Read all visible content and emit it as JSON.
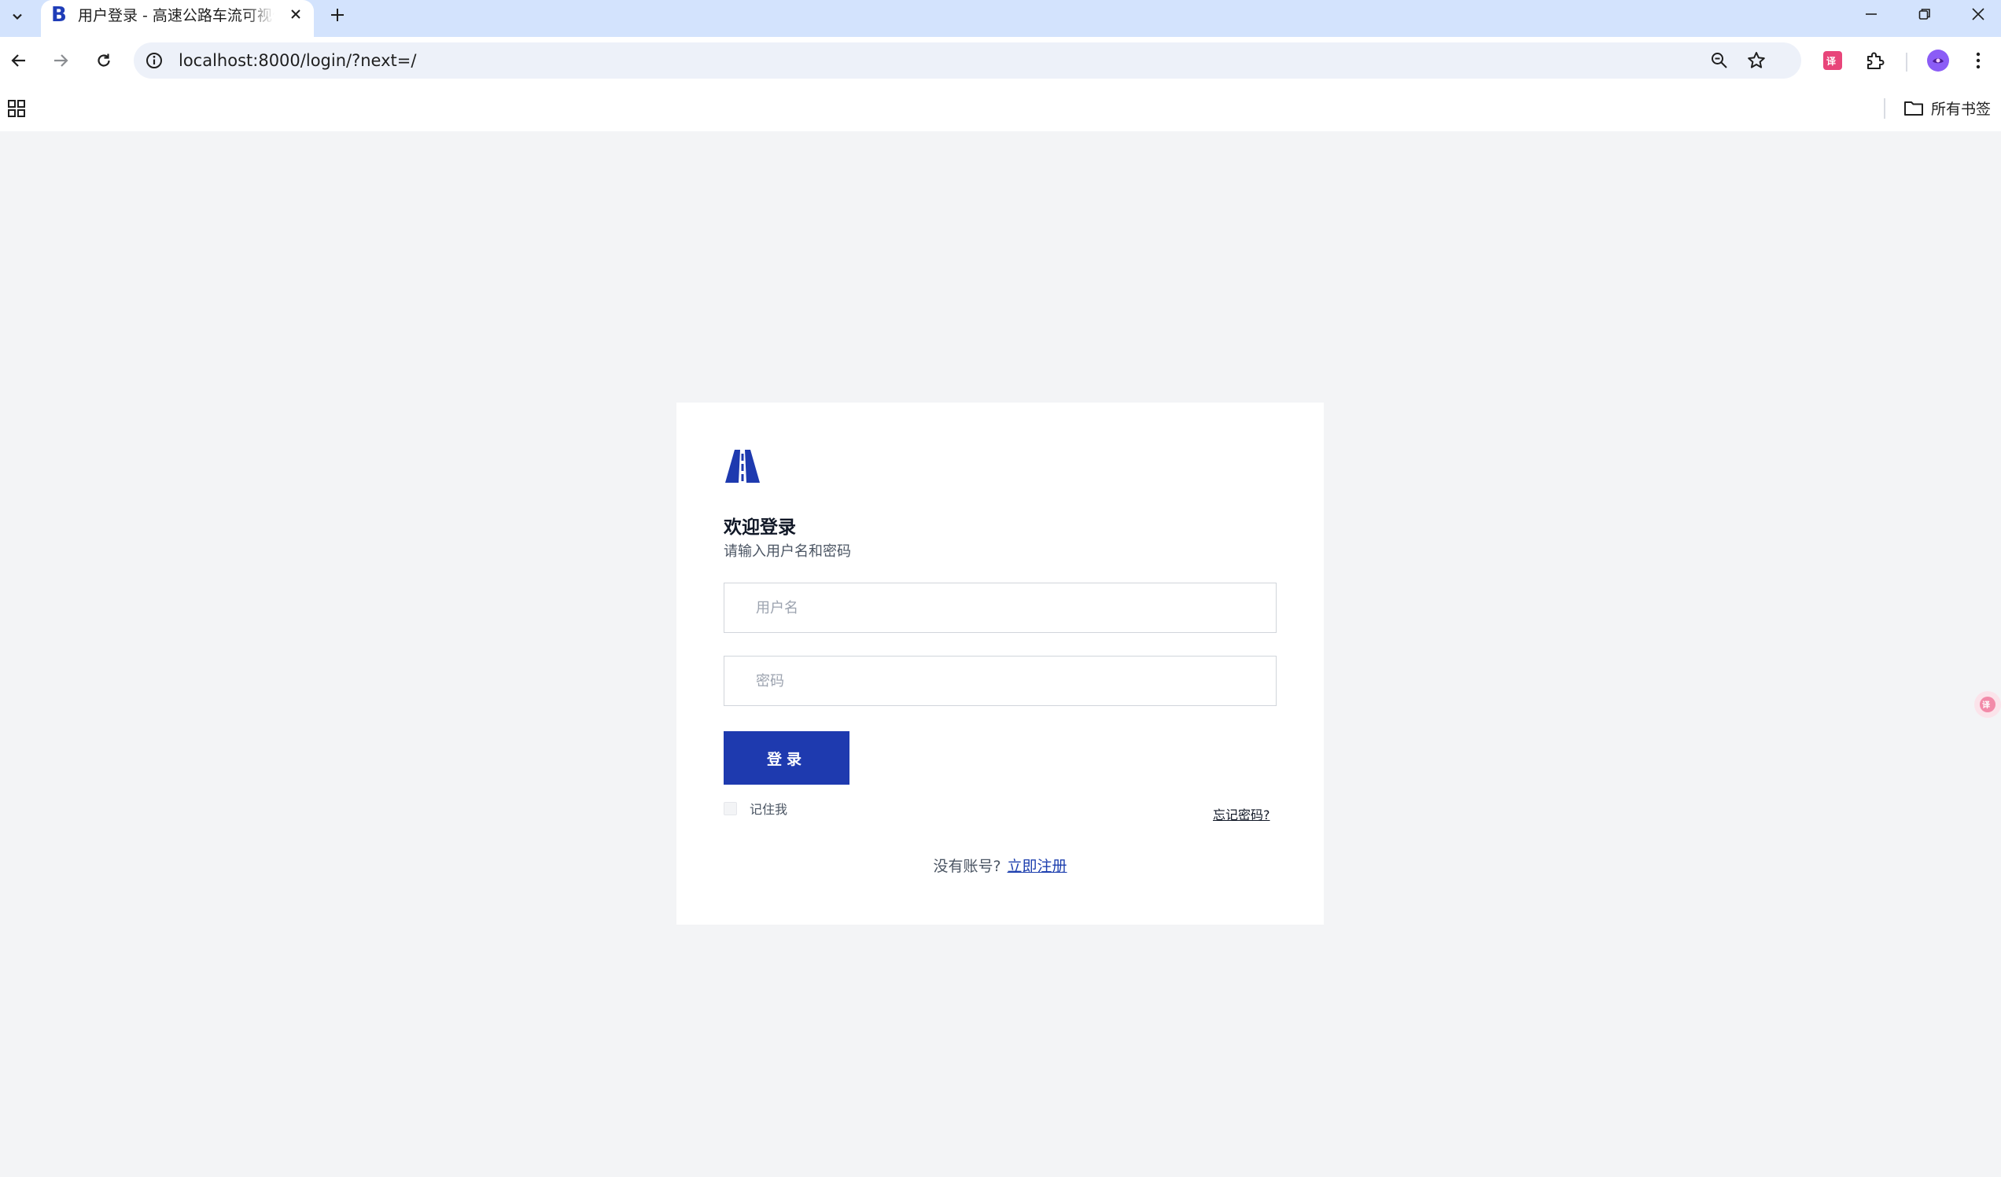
{
  "browser": {
    "tab_title": "用户登录 - 高速公路车流可视化",
    "favicon_letter": "B",
    "url": "localhost:8000/login/?next=/",
    "all_bookmarks_label": "所有书签"
  },
  "login": {
    "title": "欢迎登录",
    "subtitle": "请输入用户名和密码",
    "username_placeholder": "用户名",
    "password_placeholder": "密码",
    "login_button": "登录",
    "remember_me": "记住我",
    "forgot_password": "忘记密码?",
    "no_account_text": "没有账号?",
    "register_link": "立即注册"
  },
  "colors": {
    "brand": "#1e3aaf",
    "tabbar": "#d3e3fd",
    "page_bg": "#f3f4f6"
  }
}
